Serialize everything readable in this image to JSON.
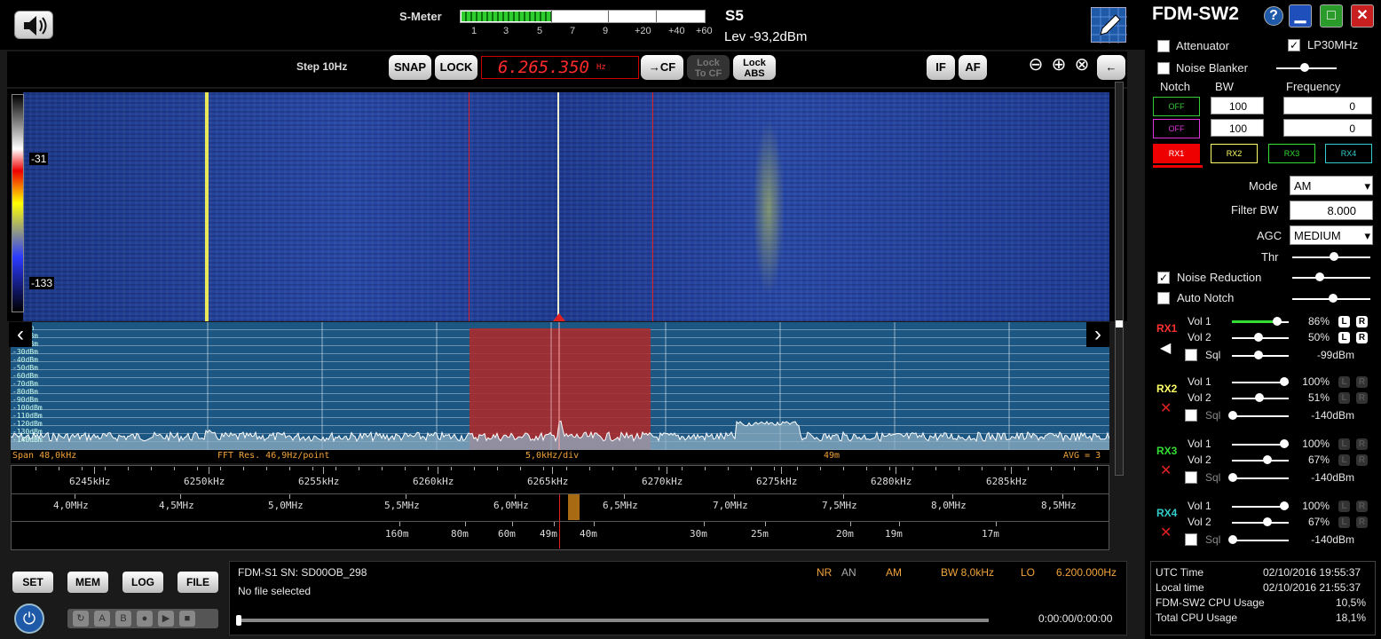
{
  "smeter": {
    "label": "S-Meter",
    "scale": [
      "1",
      "3",
      "5",
      "7",
      "9",
      "+20",
      "+40",
      "+60"
    ],
    "level": 0.37,
    "s_value": "S5",
    "lev": "Lev -93,2dBm"
  },
  "toolbar": {
    "step": "Step 10Hz",
    "snap": "SNAP",
    "lock": "LOCK",
    "freq": "6.265.350",
    "freq_unit": "Hz",
    "to_cf": "→CF",
    "lock_to_cf_1": "Lock",
    "lock_to_cf_2": "To CF",
    "lock_abs_1": "Lock",
    "lock_abs_2": "ABS",
    "if": "IF",
    "af": "AF",
    "back": "←"
  },
  "colorbar": {
    "top": "-31",
    "bottom": "-133"
  },
  "spectrum": {
    "db_labels": [
      "-0dBm",
      "-10dBm",
      "-20dBm",
      "-30dBm",
      "-40dBm",
      "-50dBm",
      "-60dBm",
      "-70dBm",
      "-80dBm",
      "-90dBm",
      "-100dBm",
      "-110dBm",
      "-120dBm",
      "-130dBm",
      "-140dBm"
    ]
  },
  "infostrip": {
    "span": "Span 48,0kHz",
    "fft": "FFT Res. 46,9Hz/point",
    "div": "5,0kHz/div",
    "band": "49m",
    "avg": "AVG = 3"
  },
  "scale_khz": [
    "6245kHz",
    "6250kHz",
    "6255kHz",
    "6260kHz",
    "6265kHz",
    "6270kHz",
    "6275kHz",
    "6280kHz",
    "6285kHz"
  ],
  "scale_mhz": [
    "4,0MHz",
    "4,5MHz",
    "5,0MHz",
    "5,5MHz",
    "6,0MHz",
    "6,5MHz",
    "7,0MHz",
    "7,5MHz",
    "8,0MHz",
    "8,5MHz"
  ],
  "scale_bands": [
    "160m",
    "80m",
    "60m",
    "49m",
    "40m",
    "30m",
    "25m",
    "20m",
    "19m",
    "17m"
  ],
  "bottom": {
    "set": "SET",
    "mem": "MEM",
    "log": "LOG",
    "file": "FILE",
    "device": "FDM-S1 SN: SD00OB_298",
    "file_status": "No file selected",
    "nr": "NR",
    "an": "AN",
    "mode": "AM",
    "bw": "BW 8,0kHz",
    "lo_label": "LO",
    "lo": "6.200.000Hz",
    "time": "0:00:00/0:00:00"
  },
  "panel": {
    "title": "FDM-SW2",
    "help": "?",
    "attenuator": "Attenuator",
    "lp30": "LP30MHz",
    "noise_blanker": "Noise Blanker",
    "notch": "Notch",
    "bw": "BW",
    "frequency": "Frequency",
    "off1": "OFF",
    "off2": "OFF",
    "bw1": "100",
    "bw2": "100",
    "f1": "0",
    "f2": "0",
    "rx_tabs": [
      "RX1",
      "RX2",
      "RX3",
      "RX4"
    ],
    "mode_label": "Mode",
    "mode": "AM",
    "filterbw_label": "Filter BW",
    "filterbw": "8.000",
    "agc_label": "AGC",
    "agc": "MEDIUM",
    "thr": "Thr",
    "noise_reduction": "Noise Reduction",
    "auto_notch": "Auto Notch",
    "rx": [
      {
        "name": "RX1",
        "vol1": "Vol 1",
        "v1": "86%",
        "vol2": "Vol 2",
        "v2": "50%",
        "sql": "Sql",
        "sqlv": "-99dBm",
        "color": "#ff3030",
        "lev1": 0.86,
        "lev2": 0.5,
        "lev3": 0.5
      },
      {
        "name": "RX2",
        "vol1": "Vol 1",
        "v1": "100%",
        "vol2": "Vol 2",
        "v2": "51%",
        "sql": "Sql",
        "sqlv": "-140dBm",
        "color": "#ffff66",
        "lev1": 1.0,
        "lev2": 0.51,
        "lev3": 0.0
      },
      {
        "name": "RX3",
        "vol1": "Vol 1",
        "v1": "100%",
        "vol2": "Vol 2",
        "v2": "67%",
        "sql": "Sql",
        "sqlv": "-140dBm",
        "color": "#33dd33",
        "lev1": 1.0,
        "lev2": 0.67,
        "lev3": 0.0
      },
      {
        "name": "RX4",
        "vol1": "Vol 1",
        "v1": "100%",
        "vol2": "Vol 2",
        "v2": "67%",
        "sql": "Sql",
        "sqlv": "-140dBm",
        "color": "#33cccc",
        "lev1": 1.0,
        "lev2": 0.67,
        "lev3": 0.0
      }
    ],
    "lr_l": "L",
    "lr_r": "R"
  },
  "status": {
    "utc_label": "UTC Time",
    "utc": "02/10/2016 19:55:37",
    "local_label": "Local time",
    "local": "02/10/2016 21:55:37",
    "cpu_label": "FDM-SW2 CPU Usage",
    "cpu": "10,5%",
    "total_label": "Total CPU Usage",
    "total": "18,1%"
  },
  "colors": {
    "accent_red": "#ff2a2a",
    "orange": "#f2a33a",
    "spectrum_bg": "#1c5682"
  }
}
